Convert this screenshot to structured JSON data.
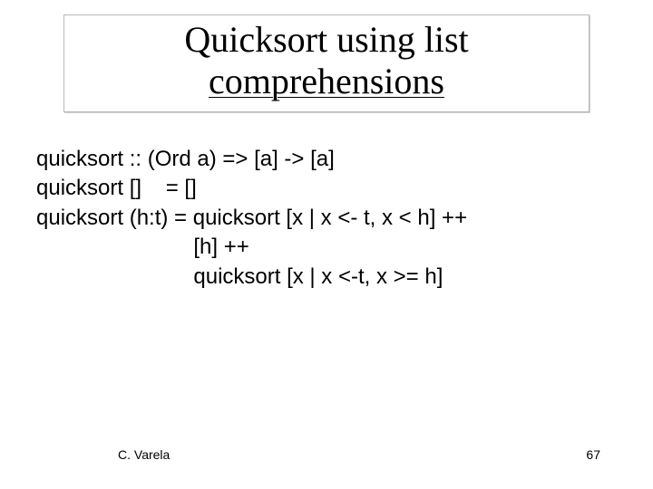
{
  "title": {
    "line1": "Quicksort using list",
    "line2": "comprehensions"
  },
  "code": {
    "l1": "quicksort :: (Ord a) => [a] -> [a]",
    "l2": "quicksort []    = []",
    "l3": "quicksort (h:t) = quicksort [x | x <- t, x < h] ++",
    "l4": "                          [h] ++",
    "l5": "                          quicksort [x | x <-t, x >= h]"
  },
  "footer": {
    "author": "C. Varela",
    "page": "67"
  }
}
